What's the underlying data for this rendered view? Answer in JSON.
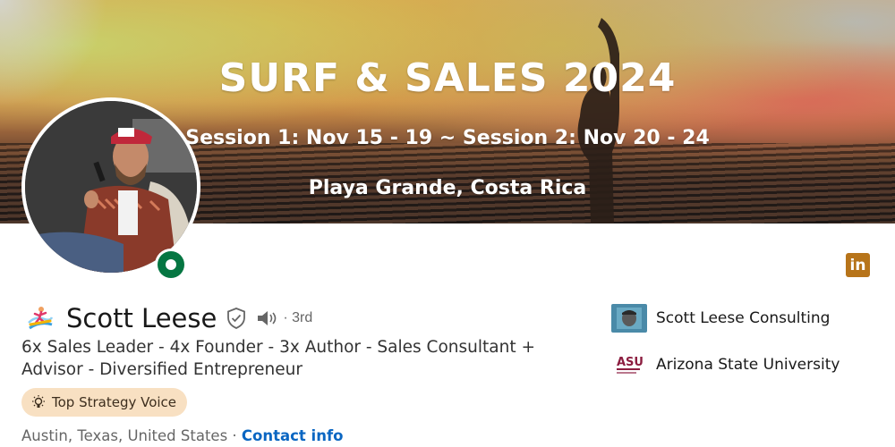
{
  "banner": {
    "title": "SURF & SALES 2024",
    "sessions": "Session 1: Nov 15 - 19  ~  Session 2: Nov 20 - 24",
    "location": "Playa Grande, Costa Rica"
  },
  "profile": {
    "name": "Scott Leese",
    "degree": "· 3rd",
    "headline": "6x Sales Leader - 4x Founder - 3x Author - Sales Consultant + Advisor - Diversified Entrepreneur",
    "badge": "Top Strategy Voice",
    "location": "Austin, Texas, United States",
    "location_sep": " · ",
    "contact_link": "Contact info",
    "open_badge_color": "#057642"
  },
  "sidebar": {
    "company": "Scott Leese Consulting",
    "school": "Arizona State University",
    "school_logo_text": "ASU",
    "social_icon": "in"
  },
  "colors": {
    "link": "#0a66c2",
    "badge_bg": "#f8e0c2",
    "linkedin_icon": "#b7741a"
  },
  "icons": {
    "surf": "surfer-emoji-icon",
    "verify": "shield-check-icon",
    "speaker": "speaker-icon",
    "bulb": "lightbulb-icon",
    "linkedin": "linkedin-icon"
  }
}
